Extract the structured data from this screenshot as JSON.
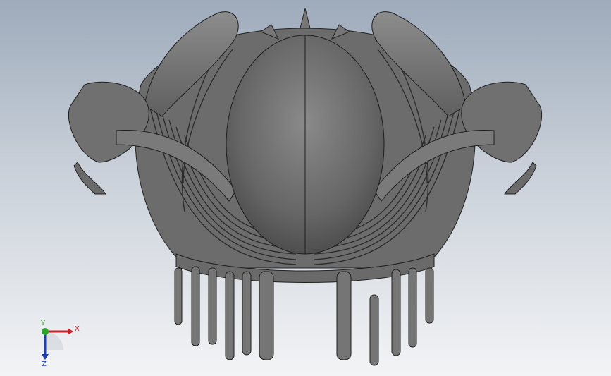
{
  "viewport": {
    "background_top": "#9eabbb",
    "background_bottom": "#f3f4f6",
    "model_color": "#6f6f6f",
    "model_highlight": "#9a9a9a",
    "edge_color": "#1e1e1e"
  },
  "triad": {
    "x_label": "X",
    "y_label": "Y",
    "z_label": "Z",
    "x_color": "#c0262b",
    "y_color": "#2aa52a",
    "z_color": "#1f3fb0"
  }
}
